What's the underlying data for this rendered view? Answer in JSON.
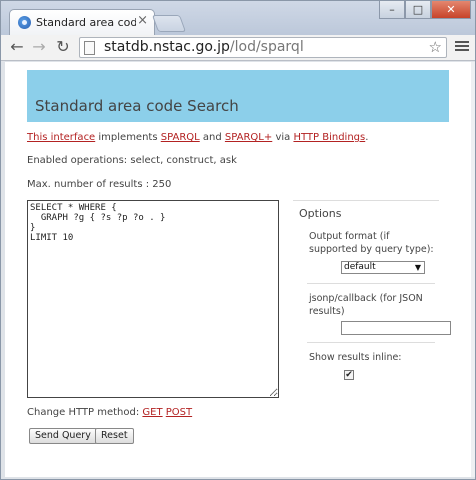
{
  "browser": {
    "tab_title": "Standard area code Sea",
    "tab_close": "×",
    "url_host": "statdb.nstac.go.jp",
    "url_path": "/lod/sparql",
    "win_min": "–",
    "win_max": "□",
    "win_close": "✕"
  },
  "page": {
    "banner_title": "Standard area code Search",
    "intro": {
      "link1": "This interface",
      "text1": " implements ",
      "link2": "SPARQL",
      "text2": " and ",
      "link3": "SPARQL+",
      "text3": " via ",
      "link4": "HTTP Bindings",
      "text4": "."
    },
    "enabled_operations": "Enabled operations: select, construct, ask",
    "max_results": "Max. number of results : 250",
    "query_text": "SELECT * WHERE {\n  GRAPH ?g { ?s ?p ?o . }\n}\nLIMIT 10",
    "change_method_label": "Change HTTP method: ",
    "method_get": "GET",
    "method_post": "POST",
    "send_button": "Send Query",
    "reset_button": "Reset"
  },
  "options": {
    "title": "Options",
    "output_format_label": "Output format (if supported by query type):",
    "output_format_value": "default",
    "jsonp_label": "jsonp/callback (for JSON results)",
    "jsonp_value": "",
    "inline_label": "Show results inline:",
    "inline_checked": true,
    "checkmark": "✔"
  },
  "colors": {
    "banner": "#8ccfea",
    "link": "#b32222"
  }
}
